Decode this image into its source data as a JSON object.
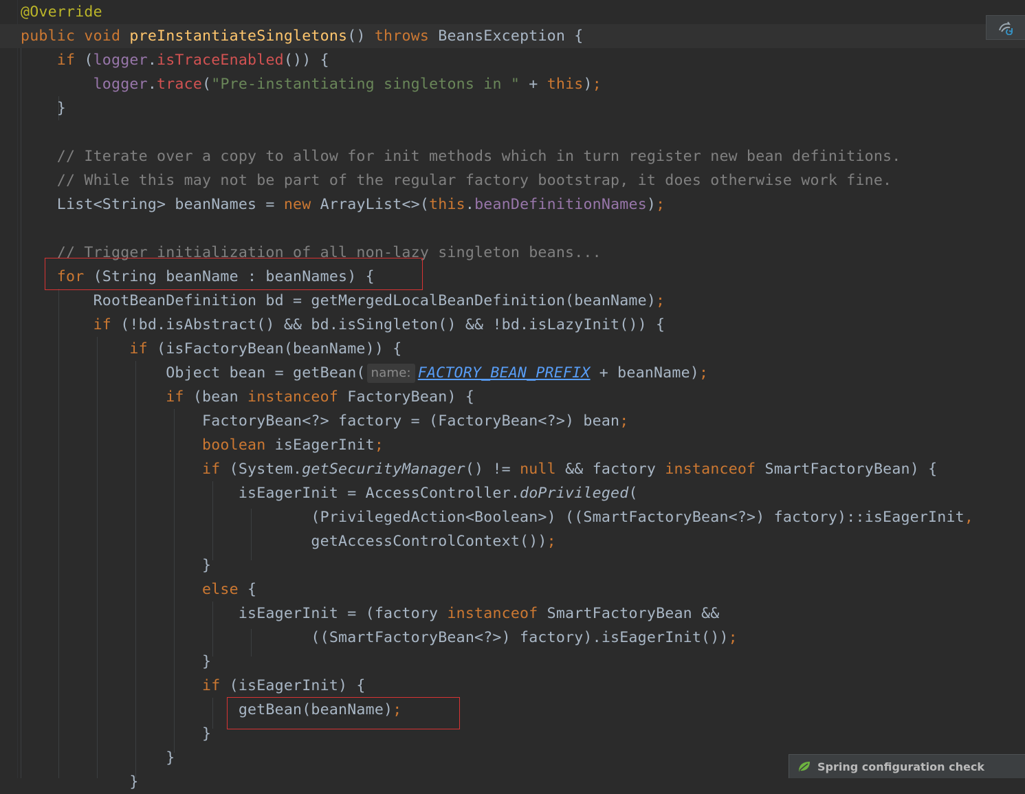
{
  "editor": {
    "code_lines": [
      [
        [
          "@Override",
          "ann"
        ]
      ],
      [
        [
          "public ",
          "kw"
        ],
        [
          "void ",
          "kw"
        ],
        [
          "preInstantiateSingletons",
          "fn"
        ],
        [
          "() ",
          ""
        ],
        [
          "throws ",
          "kw"
        ],
        [
          "BeansException {",
          ""
        ]
      ],
      [
        [
          "    if ",
          "kw"
        ],
        [
          "(",
          ""
        ],
        [
          "logger",
          "field"
        ],
        [
          ".",
          ""
        ],
        [
          "isTraceEnabled",
          "err"
        ],
        [
          "()) {",
          ""
        ]
      ],
      [
        [
          "        ",
          ""
        ],
        [
          "logger",
          "field"
        ],
        [
          ".",
          ""
        ],
        [
          "trace",
          "err"
        ],
        [
          "(",
          ""
        ],
        [
          "\"Pre-instantiating singletons in \"",
          "str"
        ],
        [
          " + ",
          ""
        ],
        [
          "this",
          "kw"
        ],
        [
          ")",
          ""
        ],
        [
          ";",
          "kw"
        ]
      ],
      [
        [
          "    }",
          ""
        ]
      ],
      [],
      [
        [
          "    // Iterate over a copy to allow for init methods which in turn register new bean definitions.",
          "cmt"
        ]
      ],
      [
        [
          "    // While this may not be part of the regular factory bootstrap, it does otherwise work fine.",
          "cmt"
        ]
      ],
      [
        [
          "    List<String> beanNames = ",
          ""
        ],
        [
          "new ",
          "kw"
        ],
        [
          "ArrayList<>(",
          ""
        ],
        [
          "this",
          "kw"
        ],
        [
          ".",
          ""
        ],
        [
          "beanDefinitionNames",
          "field"
        ],
        [
          ")",
          ""
        ],
        [
          ";",
          "kw"
        ]
      ],
      [],
      [
        [
          "    // Trigger initialization of all non-lazy singleton beans...",
          "cmt"
        ]
      ],
      [
        [
          "    for ",
          "kw"
        ],
        [
          "(String beanName : beanNames) {",
          ""
        ]
      ],
      [
        [
          "        RootBeanDefinition bd = getMergedLocalBeanDefinition(beanName)",
          ""
        ],
        [
          ";",
          "kw"
        ]
      ],
      [
        [
          "        if ",
          "kw"
        ],
        [
          "(!bd.isAbstract() && bd.isSingleton() && !bd.isLazyInit()) {",
          ""
        ]
      ],
      [
        [
          "            if ",
          "kw"
        ],
        [
          "(isFactoryBean(beanName)) {",
          ""
        ]
      ],
      [
        [
          "                Object bean = getBean(",
          ""
        ],
        [
          "name:",
          "hint"
        ],
        [
          "FACTORY_BEAN_PREFIX",
          "static"
        ],
        [
          " + beanName)",
          ""
        ],
        [
          ";",
          "kw"
        ]
      ],
      [
        [
          "                if ",
          "kw"
        ],
        [
          "(bean ",
          ""
        ],
        [
          "instanceof ",
          "kw"
        ],
        [
          "FactoryBean) {",
          ""
        ]
      ],
      [
        [
          "                    FactoryBean<?> factory = (FactoryBean<?>) bean",
          ""
        ],
        [
          ";",
          "kw"
        ]
      ],
      [
        [
          "                    boolean ",
          "kw"
        ],
        [
          "isEagerInit",
          ""
        ],
        [
          ";",
          "kw"
        ]
      ],
      [
        [
          "                    if ",
          "kw"
        ],
        [
          "(System.",
          ""
        ],
        [
          "getSecurityManager",
          "italic"
        ],
        [
          "() != ",
          ""
        ],
        [
          "null ",
          "kw"
        ],
        [
          "&& factory ",
          ""
        ],
        [
          "instanceof ",
          "kw"
        ],
        [
          "SmartFactoryBean) {",
          ""
        ]
      ],
      [
        [
          "                        isEagerInit = AccessController.",
          ""
        ],
        [
          "doPrivileged",
          "italic"
        ],
        [
          "(",
          ""
        ]
      ],
      [
        [
          "                                (PrivilegedAction<Boolean>) ((SmartFactoryBean<?>) factory)::isEagerInit",
          ""
        ],
        [
          ",",
          "kw"
        ]
      ],
      [
        [
          "                                getAccessControlContext())",
          ""
        ],
        [
          ";",
          "kw"
        ]
      ],
      [
        [
          "                    }",
          ""
        ]
      ],
      [
        [
          "                    else ",
          "kw"
        ],
        [
          "{",
          ""
        ]
      ],
      [
        [
          "                        isEagerInit = (factory ",
          ""
        ],
        [
          "instanceof ",
          "kw"
        ],
        [
          "SmartFactoryBean &&",
          ""
        ]
      ],
      [
        [
          "                                ((SmartFactoryBean<?>) factory).isEagerInit())",
          ""
        ],
        [
          ";",
          "kw"
        ]
      ],
      [
        [
          "                    }",
          ""
        ]
      ],
      [
        [
          "                    if ",
          "kw"
        ],
        [
          "(isEagerInit) {",
          ""
        ]
      ],
      [
        [
          "                        getBean(beanName)",
          ""
        ],
        [
          ";",
          "kw"
        ]
      ],
      [
        [
          "                    }",
          ""
        ]
      ],
      [
        [
          "                }",
          ""
        ]
      ],
      [
        [
          "            }",
          ""
        ]
      ]
    ]
  },
  "notification": {
    "label": "Spring configuration check"
  },
  "colors": {
    "background": "#2b2b2b",
    "keyword": "#cc7832",
    "annotation": "#bbb529",
    "method_declaration": "#ffc66d",
    "field": "#9876aa",
    "string": "#6a8759",
    "comment": "#808080",
    "highlight_box": "#d93434"
  },
  "icons": {
    "corner_action": "maven-reload-icon",
    "notification": "spring-leaf-icon"
  }
}
